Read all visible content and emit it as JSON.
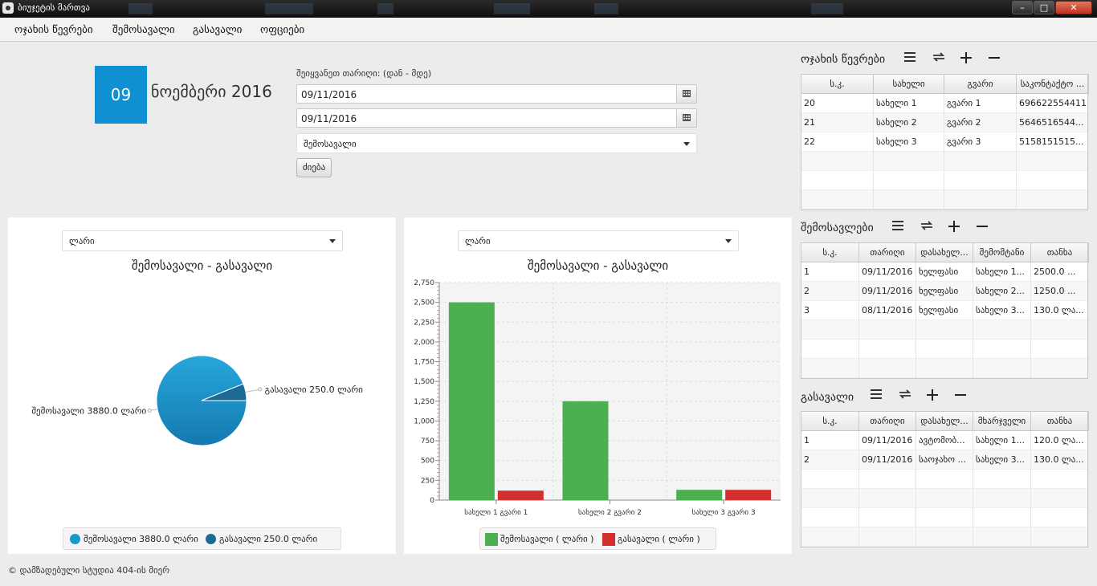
{
  "window": {
    "title": "ბიუჯეტის მართვა",
    "minimize": "–",
    "maximize": "□",
    "close": "✕"
  },
  "menu": [
    "ოჯახის წევრები",
    "შემოსავალი",
    "გასავალი",
    "ოფციები"
  ],
  "date": {
    "day": "09",
    "month_year": "ნოემბერი 2016"
  },
  "filter": {
    "label": "შეიყვანეთ თარიღი: (დან - მდე)",
    "from": "09/11/2016",
    "to": "09/11/2016",
    "type": "შემოსავალი",
    "search_button": "ძიება"
  },
  "pie_panel": {
    "currency": "ლარი"
  },
  "bar_panel": {
    "currency": "ლარი"
  },
  "chart_data": [
    {
      "type": "pie",
      "title": "შემოსავალი - გასავალი",
      "slices": [
        {
          "label": "შემოსავალი 3880.0 ლარი",
          "value": 3880.0,
          "color": "#1b97cf"
        },
        {
          "label": "გასავალი 250.0 ლარი",
          "value": 250.0,
          "color": "#1a6a93"
        }
      ],
      "legend": [
        "შემოსავალი 3880.0 ლარი",
        "გასავალი 250.0 ლარი"
      ],
      "legend_position": "bottom"
    },
    {
      "type": "bar",
      "title": "შემოსავალი - გასავალი",
      "categories": [
        "სახელი 1 გვარი 1",
        "სახელი 2 გვარი 2",
        "სახელი 3 გვარი 3"
      ],
      "series": [
        {
          "name": "შემოსავალი ( ლარი )",
          "values": [
            2500,
            1250,
            130
          ],
          "color": "#4caf50"
        },
        {
          "name": "გასავალი ( ლარი )",
          "values": [
            120,
            0,
            130
          ],
          "color": "#d32f2f"
        }
      ],
      "yticks": [
        "0",
        "250",
        "500",
        "750",
        "1,000",
        "1,250",
        "1,500",
        "1,750",
        "2,000",
        "2,250",
        "2,500",
        "2,750"
      ],
      "ylim": [
        0,
        2750
      ],
      "grid": true,
      "legend_position": "bottom"
    }
  ],
  "members": {
    "title": "ოჯახის წევრები",
    "columns": [
      "ს.კ.",
      "სახელი",
      "გვარი",
      "საკონტაქტო ..."
    ],
    "rows": [
      [
        "20",
        "სახელი 1",
        "გვარი 1",
        "696622554411"
      ],
      [
        "21",
        "სახელი 2",
        "გვარი 2",
        "5646516544..."
      ],
      [
        "22",
        "სახელი 3",
        "გვარი 3",
        "5158151515..."
      ]
    ]
  },
  "incomes": {
    "title": "შემოსავლები",
    "columns": [
      "ს.კ.",
      "თარიღი",
      "დასახელ...",
      "შემომტანი",
      "თანხა"
    ],
    "rows": [
      [
        "1",
        "09/11/2016",
        "ხელფასი",
        "სახელი 1...",
        "2500.0 ..."
      ],
      [
        "2",
        "09/11/2016",
        "ხელფასი",
        "სახელი 2...",
        "1250.0 ..."
      ],
      [
        "3",
        "08/11/2016",
        "ხელფასი",
        "სახელი 3...",
        "130.0 ლა..."
      ]
    ]
  },
  "expenses": {
    "title": "გასავალი",
    "columns": [
      "ს.კ.",
      "თარიღი",
      "დასახელ...",
      "მხარჯველი",
      "თანხა"
    ],
    "rows": [
      [
        "1",
        "09/11/2016",
        "ავტომობ...",
        "სახელი 1...",
        "120.0 ლა..."
      ],
      [
        "2",
        "09/11/2016",
        "საოჯახო ...",
        "სახელი 3...",
        "130.0 ლა..."
      ]
    ]
  },
  "toolbar_icons": [
    "list-icon",
    "refresh-icon",
    "add-icon",
    "remove-icon"
  ],
  "footer": "© დამზადებული სტუდია 404-ის მიერ"
}
